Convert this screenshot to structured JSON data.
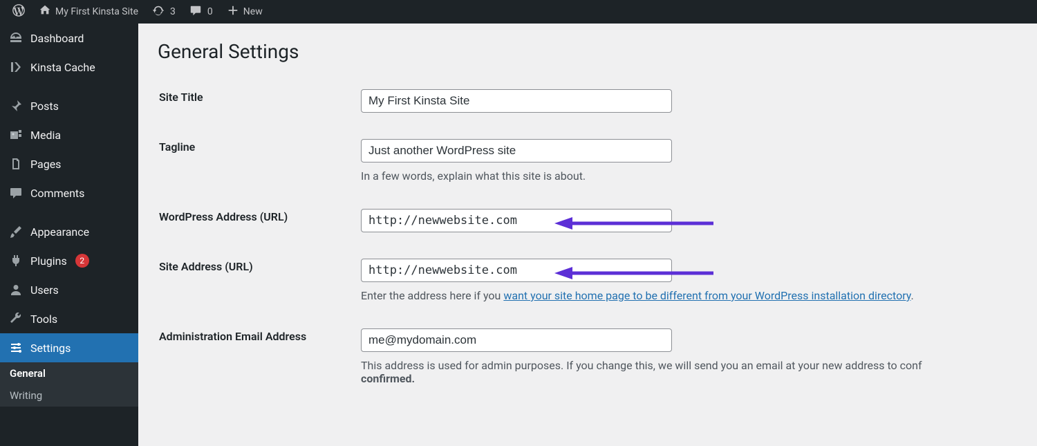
{
  "adminbar": {
    "site_title": "My First Kinsta Site",
    "updates_count": "3",
    "comments_count": "0",
    "new_label": "New"
  },
  "sidebar": {
    "dashboard": "Dashboard",
    "kinsta_cache": "Kinsta Cache",
    "posts": "Posts",
    "media": "Media",
    "pages": "Pages",
    "comments": "Comments",
    "appearance": "Appearance",
    "plugins": "Plugins",
    "plugins_badge": "2",
    "users": "Users",
    "tools": "Tools",
    "settings": "Settings",
    "submenu": {
      "general": "General",
      "writing": "Writing"
    }
  },
  "page": {
    "heading": "General Settings"
  },
  "fields": {
    "site_title": {
      "label": "Site Title",
      "value": "My First Kinsta Site"
    },
    "tagline": {
      "label": "Tagline",
      "value": "Just another WordPress site",
      "desc": "In a few words, explain what this site is about."
    },
    "wp_url": {
      "label": "WordPress Address (URL)",
      "value": "http://newwebsite.com"
    },
    "site_url": {
      "label": "Site Address (URL)",
      "value": "http://newwebsite.com",
      "desc_prefix": "Enter the address here if you ",
      "desc_link": "want your site home page to be different from your WordPress installation directory",
      "desc_suffix": "."
    },
    "admin_email": {
      "label": "Administration Email Address",
      "value": "me@mydomain.com",
      "desc_prefix": "This address is used for admin purposes. If you change this, we will send you an email at your new address to conf",
      "desc_strong": "confirmed."
    }
  },
  "annotation_color": "#5c2fd6"
}
